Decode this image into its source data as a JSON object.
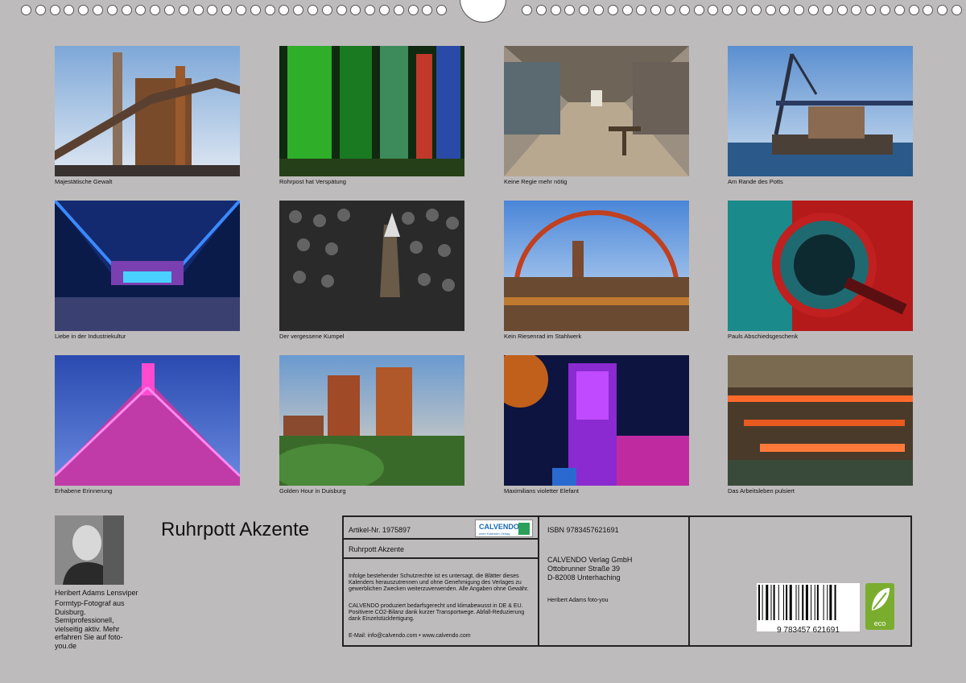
{
  "calendar_title": "Ruhrpott Akzente",
  "photos": [
    {
      "caption": "Majestätische Gewalt",
      "scene": "industrial-chimney"
    },
    {
      "caption": "Rohrpost hat Verspätung",
      "scene": "green-pipes"
    },
    {
      "caption": "Keine Regie mehr nötig",
      "scene": "factory-hall"
    },
    {
      "caption": "Am Rande des Potts",
      "scene": "harbor-crane"
    },
    {
      "caption": "Liebe in der Industriekultur",
      "scene": "blue-night-structure"
    },
    {
      "caption": "Der vergessene Kumpel",
      "scene": "miners-hall"
    },
    {
      "caption": "Kein Riesenrad im Stahlwerk",
      "scene": "ferris-wheel"
    },
    {
      "caption": "Pauls Abschiedsgeschenk",
      "scene": "red-valve"
    },
    {
      "caption": "Erhabene Erinnerung",
      "scene": "pink-headframe"
    },
    {
      "caption": "Golden Hour in Duisburg",
      "scene": "blast-furnace"
    },
    {
      "caption": "Maximilians violetter Elefant",
      "scene": "purple-elephant"
    },
    {
      "caption": "Das Arbeitsleben pulsiert",
      "scene": "steel-rolling"
    }
  ],
  "author": {
    "name": "Heribert Adams Lensviper",
    "bio": "Formtyp-Fotograf aus Duisburg. Semiprofessionell, vielseitig aktiv. Mehr erfahren Sie auf foto-you.de"
  },
  "info": {
    "article_no": "Artikel-Nr. 1975897",
    "product_title": "Ruhrpott Akzente",
    "legal_1": "Infolge bestehender Schutzrechte ist es untersagt, die Blätter dieses Kalenders herauszutrennen und ohne Genehmigung des Verlages zu gewerblichen Zwecken weiterzuverwenden. Alle Angaben ohne Gewähr.",
    "legal_2": "CALVENDO produziert bedarfsgerecht und klimabewusst in DE & EU. Positivere CO2-Bilanz dank kurzer Transportwege. Abfall-Reduzierung dank Einzelstückfertigung.",
    "contact": "E-Mail: info@calvendo.com • www.calvendo.com",
    "isbn": "ISBN 9783457621691",
    "publisher_lines": [
      "CALVENDO Verlag GmbH",
      "Ottobrunner Straße 39",
      "D-82008 Unterhaching"
    ],
    "photographer": "Heribert Adams foto-you",
    "barcode_number": "9 783457 621691",
    "calvendo_logo": "CALVENDO",
    "calvendo_tagline": "mein Kalender-Verlag",
    "eco_label": "eco"
  }
}
